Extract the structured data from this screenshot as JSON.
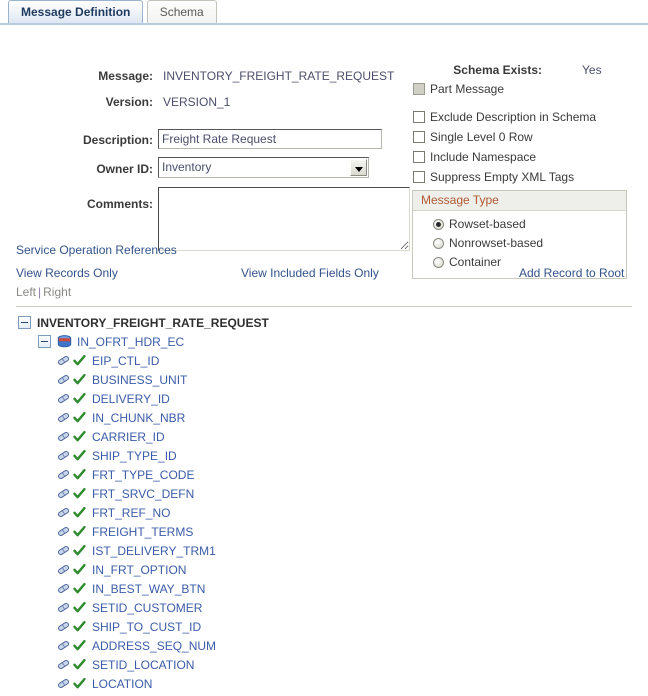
{
  "tabs": [
    {
      "label": "Message Definition",
      "active": true
    },
    {
      "label": "Schema",
      "active": false
    }
  ],
  "form": {
    "message_label": "Message:",
    "message_value": "INVENTORY_FREIGHT_RATE_REQUEST",
    "version_label": "Version:",
    "version_value": "VERSION_1",
    "description_label": "Description:",
    "description_value": "Freight Rate Request",
    "owner_label": "Owner ID:",
    "owner_value": "Inventory",
    "comments_label": "Comments:",
    "comments_value": ""
  },
  "right_panel": {
    "schema_exists_label": "Schema Exists:",
    "schema_exists_value": "Yes",
    "checkboxes": [
      {
        "label": "Part Message",
        "checked": false,
        "disabled": true
      },
      {
        "label": "Exclude Description in Schema",
        "checked": false,
        "disabled": false
      },
      {
        "label": "Single Level 0 Row",
        "checked": false,
        "disabled": false
      },
      {
        "label": "Include Namespace",
        "checked": false,
        "disabled": false
      },
      {
        "label": "Suppress Empty XML Tags",
        "checked": false,
        "disabled": false
      }
    ],
    "message_type": {
      "title": "Message Type",
      "options": [
        {
          "label": "Rowset-based",
          "selected": true
        },
        {
          "label": "Nonrowset-based",
          "selected": false
        },
        {
          "label": "Container",
          "selected": false
        }
      ]
    }
  },
  "links": {
    "service_operation_references": "Service Operation References",
    "view_records_only": "View Records Only",
    "view_included_fields_only": "View Included Fields Only",
    "add_record_to_root": "Add Record to Root",
    "left": "Left",
    "separator": "|",
    "right": "Right"
  },
  "tree": {
    "root": "INVENTORY_FREIGHT_RATE_REQUEST",
    "record": "IN_OFRT_HDR_EC",
    "fields": [
      "EIP_CTL_ID",
      "BUSINESS_UNIT",
      "DELIVERY_ID",
      "IN_CHUNK_NBR",
      "CARRIER_ID",
      "SHIP_TYPE_ID",
      "FRT_TYPE_CODE",
      "FRT_SRVC_DEFN",
      "FRT_REF_NO",
      "FREIGHT_TERMS",
      "IST_DELIVERY_TRM1",
      "IN_FRT_OPTION",
      "IN_BEST_WAY_BTN",
      "SETID_CUSTOMER",
      "SHIP_TO_CUST_ID",
      "ADDRESS_SEQ_NUM",
      "SETID_LOCATION",
      "LOCATION"
    ]
  },
  "colors": {
    "link": "#33538a",
    "tree_link": "#3b5ca8",
    "group_title": "#b05a33",
    "value_text": "#4b4f6b",
    "check_green": "#2e8b2e",
    "db_icon_blue": "#3a6fc4",
    "db_icon_red": "#cc3b2f"
  }
}
